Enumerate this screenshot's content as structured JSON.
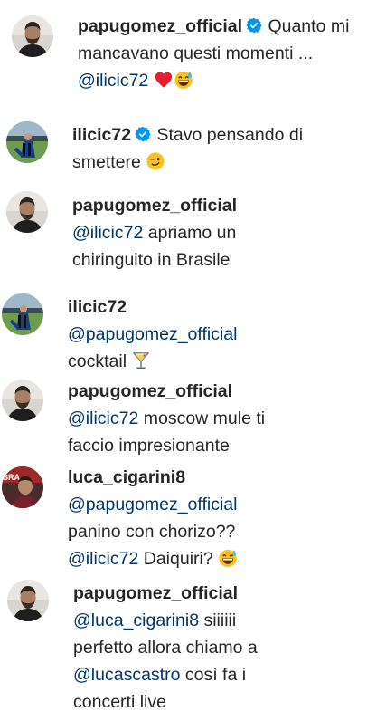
{
  "comments": [
    {
      "username": "papugomez_official",
      "verified": true,
      "lines": [
        "Quanto mi",
        "mancavano questi momenti ..."
      ],
      "mention": "@ilicic72",
      "emojis": [
        "red-heart",
        "grinning-sweat"
      ]
    },
    {
      "username": "ilicic72",
      "verified": true,
      "text_a": "Stavo pensando di",
      "text_b": "smettere",
      "emojis": [
        "winking-face"
      ]
    },
    {
      "username": "papugomez_official",
      "mention": "@ilicic72",
      "text_a": "apriamo un",
      "text_b": "chiringuito in Brasile"
    },
    {
      "username": "ilicic72",
      "mention": "@papugomez_official",
      "text_a": "cocktail",
      "emojis": [
        "cocktail-glass"
      ]
    },
    {
      "username": "papugomez_official",
      "mention": "@ilicic72",
      "text_a": "moscow mule ti",
      "text_b": "faccio impresionante"
    },
    {
      "username": "luca_cigarini8",
      "mention": "@papugomez_official",
      "text_a": "panino con chorizo??",
      "mention2": "@ilicic72",
      "text_b": "Daiquiri?",
      "emojis": [
        "grinning-sweat"
      ]
    },
    {
      "username": "papugomez_official",
      "mention": "@luca_cigarini8",
      "text_a": "siiiiii",
      "text_b": "perfetto allora chiamo a",
      "mention2": "@lucascastro",
      "text_c": "così fa i",
      "text_d": "concerti live"
    }
  ],
  "colors": {
    "text": "#262626",
    "mention": "#00376b",
    "verified": "#0095f6"
  }
}
